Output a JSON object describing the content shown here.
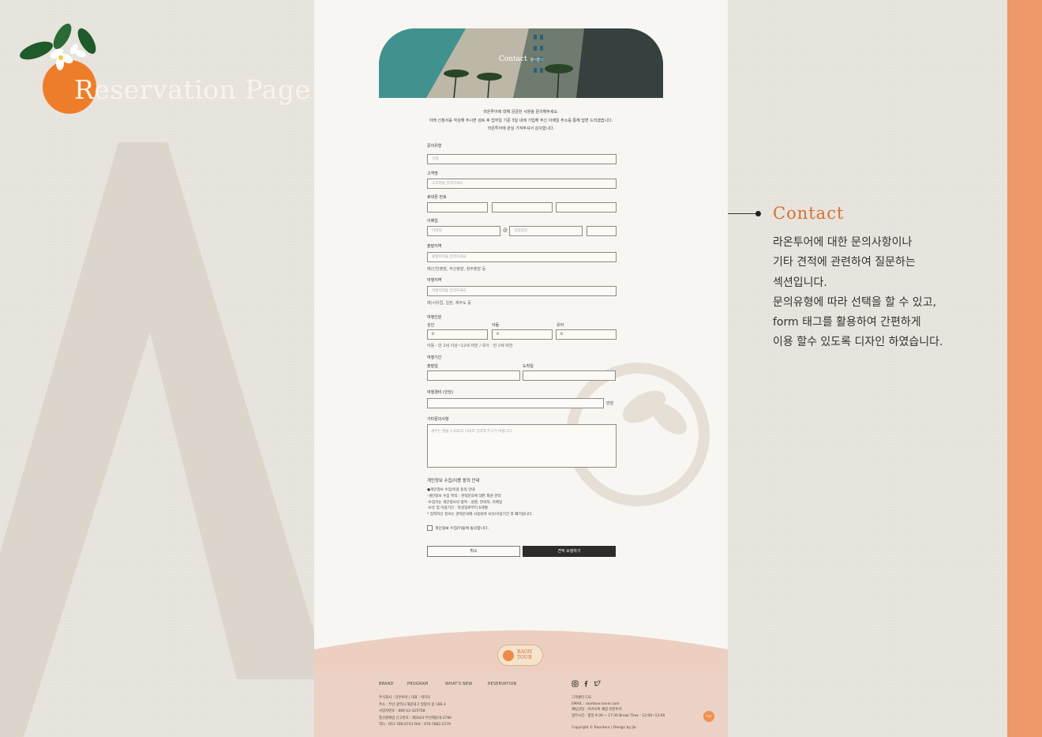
{
  "board": {
    "title": "Reservation Page",
    "accent_color": "#ef9868",
    "brand_color": "#d5712f"
  },
  "annotation": {
    "title": "Contact",
    "lines": [
      "라온투어에  대한 문의사항이나",
      "기타 견적에 관련하여 질문하는",
      "섹션입니다.",
      "문의유형에 따라 선택을 할 수 있고,",
      "form 태그를 활용하여 간편하게",
      "이용 할수 있도록 디자인 하였습니다."
    ]
  },
  "hero": {
    "title": "Contact",
    "subtitle": "견적문의"
  },
  "intro": [
    "라온투어에 대해 궁금한 사항을 문의해주세요.",
    "아래 신청서를 작성해 주시면 검토 후 업무일 기준 3일 내에 기입해 주신 이메일 주소를 통해 답변 드리겠습니다.",
    "라온투어에 관심 가져주셔서 감사합니다."
  ],
  "form": {
    "inquiry_type": {
      "label": "문의유형",
      "placeholder": "선택"
    },
    "name": {
      "label": "고객명",
      "placeholder": "고객명을 입력하세요"
    },
    "phone": {
      "label": "휴대폰 번호"
    },
    "email": {
      "label": "이메일",
      "placeholder": "이메일",
      "at": "@",
      "domain_placeholder": "직접입력"
    },
    "departure": {
      "label": "출발지역",
      "placeholder": "출발지역을 입력하세요",
      "hint": "예)인천출발, 부산출발, 청주출발 등"
    },
    "destination": {
      "label": "여행지역",
      "placeholder": "여행지역을 입력하세요",
      "hint": "예)서유럽, 일본, 제주도 등"
    },
    "travelers": {
      "label": "여행인원",
      "adult_label": "성인",
      "adult_value": "0",
      "child_label": "아동",
      "child_value": "0",
      "infant_label": "유아",
      "infant_value": "0",
      "hint": "아동 : 만 2세 이상~12세 미만 / 유아 : 만 2세 미만"
    },
    "period": {
      "label": "여행기간",
      "depart_label": "출발일",
      "arrive_label": "도착일"
    },
    "budget": {
      "label": "여행경비 (인당)",
      "unit": "만원"
    },
    "other": {
      "label": "기타문의사항",
      "placeholder": "세부는 별을 1,000자 이내로 입력해 주시기 바랍니다."
    },
    "privacy": {
      "title": "개인정보 수집/이용 동의 안내",
      "lines": [
        "●개인정보 수집/이용 동의 안내",
        "-개인정보 수집 목적 : 견적문의에 대한 회원 관리",
        "-수집하는 개인정보의 항목 : 성명, 연락처, 이메일",
        "-보유 및 이용기간 : 작성일로부터 6개월",
        "* 입력하신 정보는 견적문의에 사용되며 보유/이용기간 후 폐기됩니다."
      ],
      "agree": "개인정보 수집/이용에 동의합니다."
    },
    "cancel": "취소",
    "submit": "견적 요청하기"
  },
  "footer": {
    "logo_line1": "RAON",
    "logo_line2": "TOUR",
    "nav": [
      "BRAND",
      "PROGRAM",
      "WHAT'S NEW",
      "RESERVATION"
    ],
    "company": [
      "주식회사 : 라온투어 | 대표 : 박지오",
      "주소 : 부산 광역시 해운대구 달맞이 길 166-3",
      "사업자번호 : 669-12-325758",
      "통신판매업 신고번호 : 제2023-부산해운대-2790",
      "TEL : 051-786-6753  FAX : 070-7862-2179"
    ],
    "service": [
      "고객센터 C/S",
      "EMAIL : raontour.naver.com",
      "채팅상담 : 카카오톡 채널 라온투어",
      "업무시간 : 평일 9:30 ~ 17:30 Break Time : 12:00~13:00",
      "",
      "Copyright © Raontour | Design by Jio"
    ],
    "top": "TOP"
  }
}
